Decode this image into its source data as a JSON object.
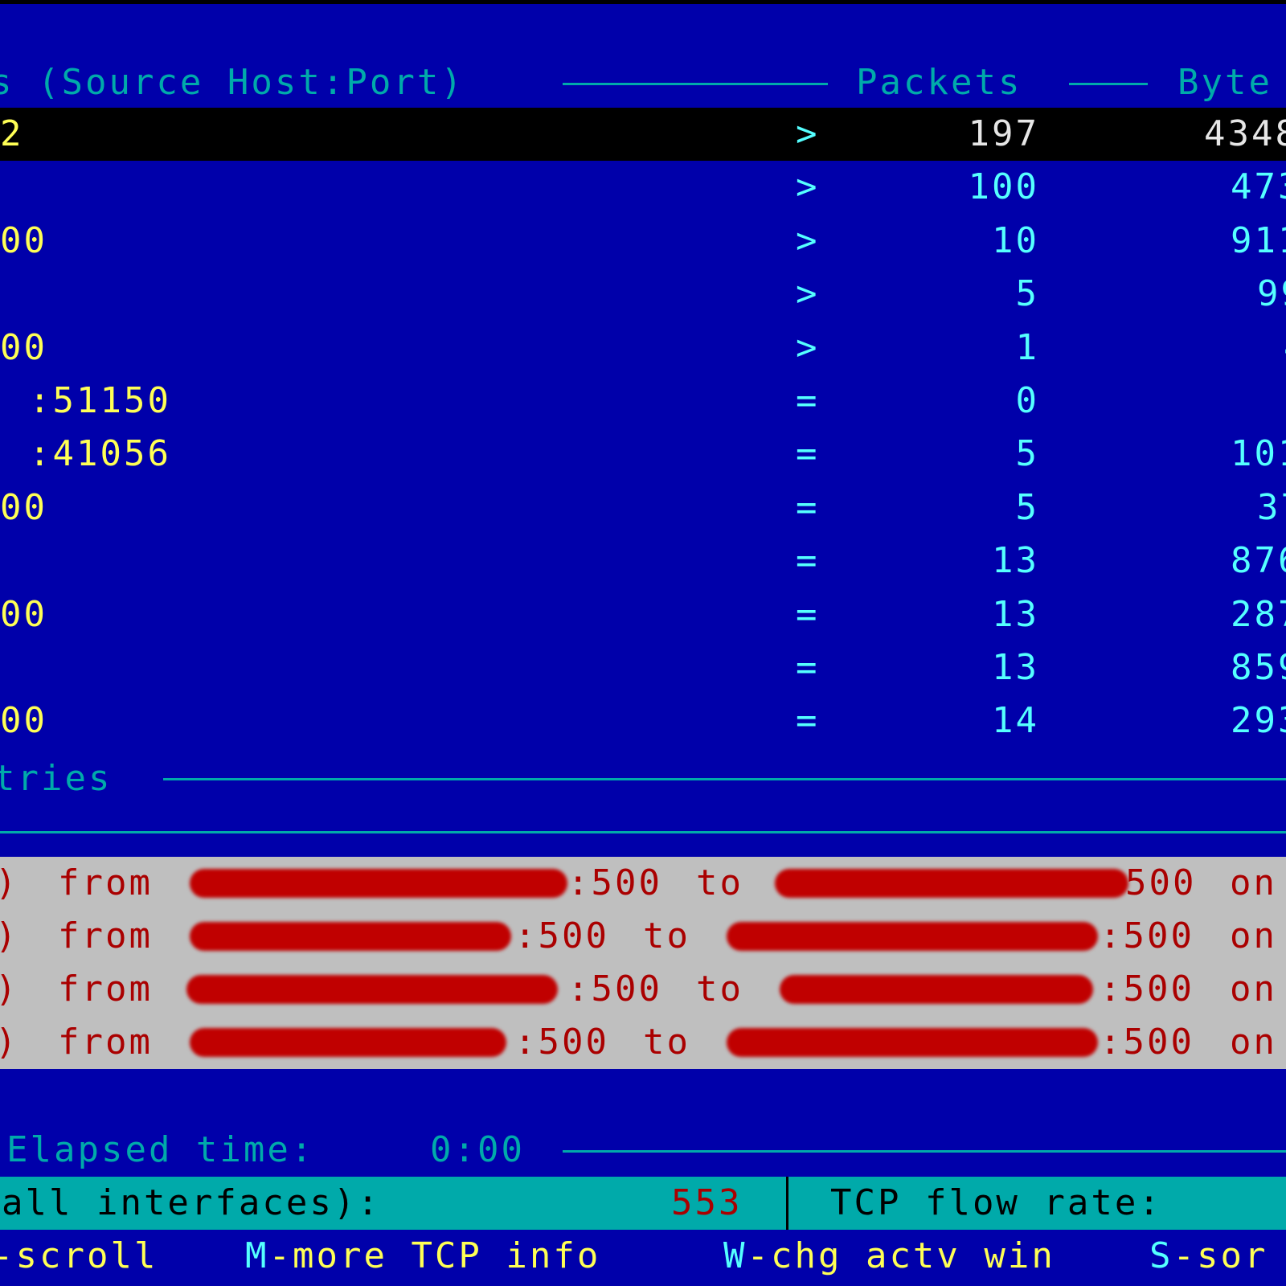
{
  "tcp_panel": {
    "header_title": "s (Source Host:Port)",
    "packets_header": "Packets",
    "bytes_header": "Byte",
    "footer_label": "tries"
  },
  "tcp_rows": [
    {
      "host": "2",
      "flag": ">",
      "packets": "197",
      "bytes": "4348"
    },
    {
      "host": "",
      "flag": ">",
      "packets": "100",
      "bytes": "473"
    },
    {
      "host": "00",
      "flag": ">",
      "packets": "10",
      "bytes": "911"
    },
    {
      "host": "",
      "flag": ">",
      "packets": "5",
      "bytes": "99"
    },
    {
      "host": "00",
      "flag": ">",
      "packets": "1",
      "bytes": "4"
    },
    {
      "host": ":51150",
      "flag": "=",
      "packets": "0",
      "bytes": ""
    },
    {
      "host": ":41056",
      "flag": "=",
      "packets": "5",
      "bytes": "101"
    },
    {
      "host": "00",
      "flag": "=",
      "packets": "5",
      "bytes": "37"
    },
    {
      "host": "",
      "flag": "=",
      "packets": "13",
      "bytes": "876"
    },
    {
      "host": "00",
      "flag": "=",
      "packets": "13",
      "bytes": "287"
    },
    {
      "host": "",
      "flag": "=",
      "packets": "13",
      "bytes": "859"
    },
    {
      "host": "00",
      "flag": "=",
      "packets": "14",
      "bytes": "293"
    }
  ],
  "udp_lines": [
    {
      "prefix": ")",
      "from": "from",
      "src_port": ":500",
      "to": "to",
      "dst_port": "500",
      "on": "on"
    },
    {
      "prefix": ")",
      "from": "from",
      "src_port": ":500",
      "to": "to",
      "dst_port": ":500",
      "on": "on"
    },
    {
      "prefix": ")",
      "from": "from",
      "src_port": ":500",
      "to": "to",
      "dst_port": ":500",
      "on": "on"
    },
    {
      "prefix": ")",
      "from": "from",
      "src_port": ":500",
      "to": "to",
      "dst_port": ":500",
      "on": "on"
    }
  ],
  "elapsed": {
    "label": "Elapsed time:",
    "value": "0:00"
  },
  "status_bar": {
    "packets_label": "all interfaces):",
    "packets_value": "553",
    "flow_label": "TCP flow rate:"
  },
  "keys": [
    {
      "key": "",
      "desc": "-scroll"
    },
    {
      "key": "M",
      "desc": "-more TCP info"
    },
    {
      "key": "W",
      "desc": "-chg actv win"
    },
    {
      "key": "S",
      "desc": "-sor"
    }
  ],
  "colors": {
    "background": "#0000aa",
    "border": "#00aaaa",
    "host_text": "#ffff55",
    "counter_text": "#55ffff",
    "udp_text": "#aa0000",
    "udp_background": "#bfbfbf",
    "status_background": "#00aaaa",
    "status_value": "#aa0000"
  }
}
